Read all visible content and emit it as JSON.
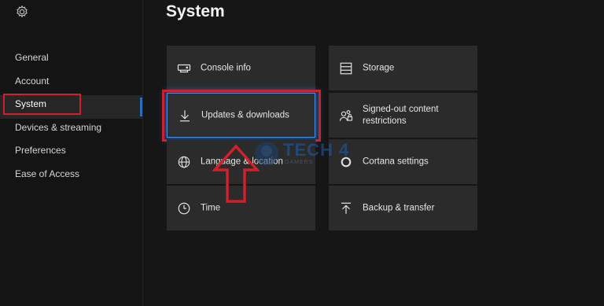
{
  "sidebar": {
    "items": [
      {
        "label": "General"
      },
      {
        "label": "Account"
      },
      {
        "label": "System"
      },
      {
        "label": "Devices & streaming"
      },
      {
        "label": "Preferences"
      },
      {
        "label": "Ease of Access"
      }
    ],
    "selected": "System"
  },
  "page": {
    "title": "System"
  },
  "tiles": [
    {
      "label": "Console info",
      "icon": "console-icon"
    },
    {
      "label": "Storage",
      "icon": "storage-icon"
    },
    {
      "label": "Updates & downloads",
      "icon": "download-icon"
    },
    {
      "label": "Signed-out content restrictions",
      "icon": "people-lock-icon"
    },
    {
      "label": "Language & location",
      "icon": "globe-icon"
    },
    {
      "label": "Cortana settings",
      "icon": "cortana-icon"
    },
    {
      "label": "Time",
      "icon": "clock-icon"
    },
    {
      "label": "Backup & transfer",
      "icon": "upload-icon"
    }
  ],
  "watermark": {
    "text": "TECH 4",
    "sub": "GAMERS"
  },
  "colors": {
    "highlight": "#d0202d",
    "focus": "#4a8fe0",
    "background": "#161616",
    "tile": "#2b2b2b"
  }
}
